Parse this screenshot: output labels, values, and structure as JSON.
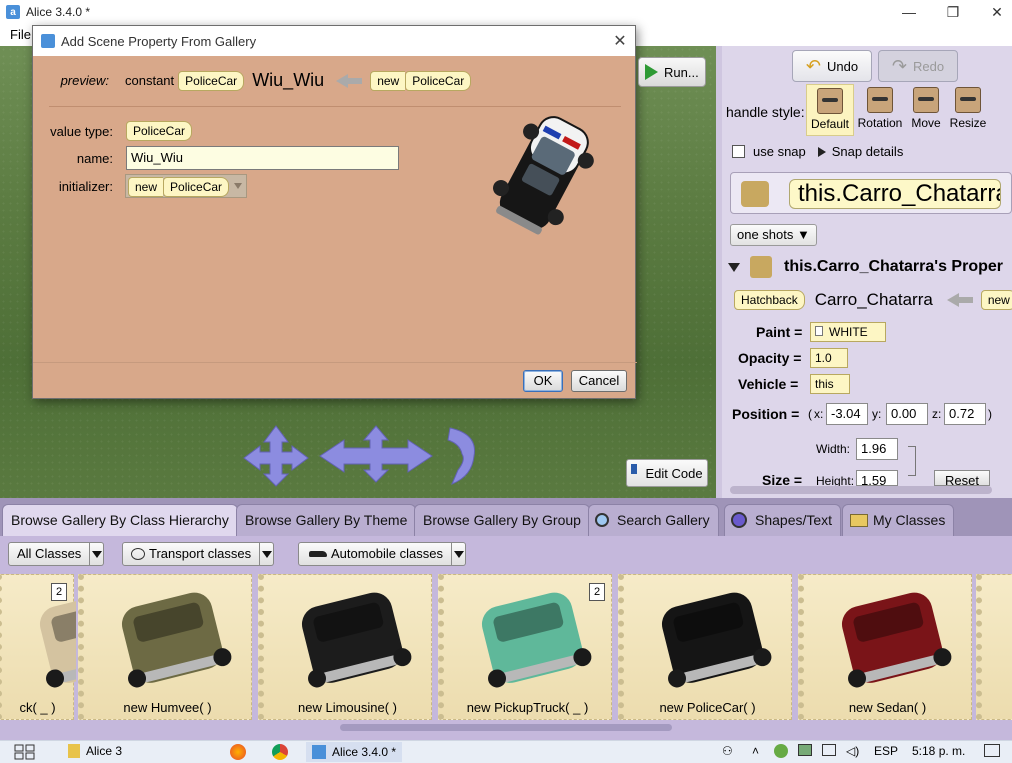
{
  "window": {
    "title": "Alice 3.4.0  *",
    "controls": [
      "—",
      "❐",
      "✕"
    ]
  },
  "menu": {
    "file": "File"
  },
  "scene": {
    "run_label": "Run...",
    "edit_code_label": "Edit Code"
  },
  "right_panel": {
    "undo": "Undo",
    "redo": "Redo",
    "handle_style_label": "handle style:",
    "handle_styles": [
      "Default",
      "Rotation",
      "Move",
      "Resize"
    ],
    "use_snap": "use snap",
    "snap_details": "Snap details",
    "selected_object": "this.Carro_Chatarra",
    "one_shots": "one shots ▼",
    "properties_header": "this.Carro_Chatarra's Proper",
    "declaration": {
      "type": "Hatchback",
      "name": "Carro_Chatarra",
      "new": "new"
    },
    "paint_label": "Paint =",
    "paint_value": "WHITE",
    "opacity_label": "Opacity =",
    "opacity_value": "1.0",
    "vehicle_label": "Vehicle =",
    "vehicle_value": "this",
    "position_label": "Position =",
    "position": {
      "x_label": "x:",
      "x": "-3.04",
      "y_label": "y:",
      "y": "0.00",
      "z_label": "z:",
      "z": "0.72",
      "open": "(",
      "close": ")"
    },
    "width_label": "Width:",
    "width_value": "1.96",
    "size_label": "Size =",
    "height_label": "Height:",
    "height_value": "1.59",
    "reset": "Reset"
  },
  "gallery": {
    "tabs": [
      "Browse Gallery By Class Hierarchy",
      "Browse Gallery By Theme",
      "Browse Gallery By Group",
      "Search Gallery",
      "Shapes/Text",
      "My Classes"
    ],
    "filters": [
      "All Classes",
      "Transport classes",
      "Automobile classes"
    ],
    "items": [
      {
        "label": "ck( _ )",
        "badge": "2",
        "color": "#d4c3a0"
      },
      {
        "label": "new Humvee( )",
        "badge": "",
        "color": "#6d6a44"
      },
      {
        "label": "new Limousine( )",
        "badge": "",
        "color": "#1c1c1c"
      },
      {
        "label": "new PickupTruck( _ )",
        "badge": "2",
        "color": "#5fb89a"
      },
      {
        "label": "new PoliceCar( )",
        "badge": "",
        "color": "#151515"
      },
      {
        "label": "new Sedan( )",
        "badge": "",
        "color": "#7a1418"
      }
    ]
  },
  "dialog": {
    "title": "Add Scene Property From Gallery",
    "preview_label": "preview:",
    "constant": "constant",
    "type_tile": "PoliceCar",
    "var_name": "Wiu_Wiu",
    "new_word": "new",
    "value_type_label": "value type:",
    "value_type": "PoliceCar",
    "name_label": "name:",
    "name_value": "Wiu_Wiu",
    "initializer_label": "initializer:",
    "initializer_new": "new",
    "initializer_type": "PoliceCar",
    "ok": "OK",
    "cancel": "Cancel"
  },
  "taskbar": {
    "folder": "Alice 3",
    "active_app": "Alice 3.4.0  *",
    "lang": "ESP",
    "time": "5:18 p. m."
  }
}
